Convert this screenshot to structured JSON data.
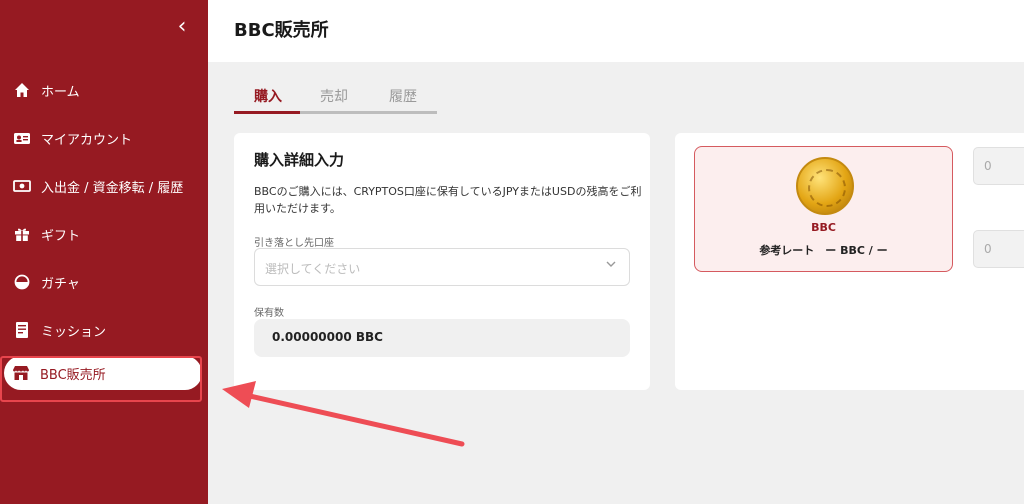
{
  "sidebar": {
    "collapse_icon": "chevron-left-icon",
    "items": [
      {
        "label": "ホーム",
        "icon": "home-icon"
      },
      {
        "label": "マイアカウント",
        "icon": "account-card-icon"
      },
      {
        "label": "入出金 / 資金移転 / 履歴",
        "icon": "cash-icon"
      },
      {
        "label": "ギフト",
        "icon": "gift-icon"
      },
      {
        "label": "ガチャ",
        "icon": "gacha-capsule-icon"
      },
      {
        "label": "ミッション",
        "icon": "mission-document-icon"
      },
      {
        "label": "BBC販売所",
        "icon": "store-icon",
        "active": true
      }
    ]
  },
  "header": {
    "title": "BBC販売所"
  },
  "tabs": [
    {
      "label": "購入",
      "active": true
    },
    {
      "label": "売却"
    },
    {
      "label": "履歴"
    }
  ],
  "purchase_card": {
    "title": "購入詳細入力",
    "description": "BBCのご購入には、CRYPTOS口座に保有しているJPYまたはUSDの残高をご利用いただけます。",
    "withdraw_label": "引き落とし先口座",
    "withdraw_placeholder": "選択してください",
    "holding_label": "保有数",
    "holding_value": "0.00000000 BBC"
  },
  "coin_card": {
    "name": "BBC",
    "rate_text": "参考レート　ー BBC / ー"
  },
  "inputs": {
    "amount_1": "0",
    "amount_2": "0"
  },
  "colors": {
    "brand": "#961a22",
    "highlight": "#e8454d"
  }
}
